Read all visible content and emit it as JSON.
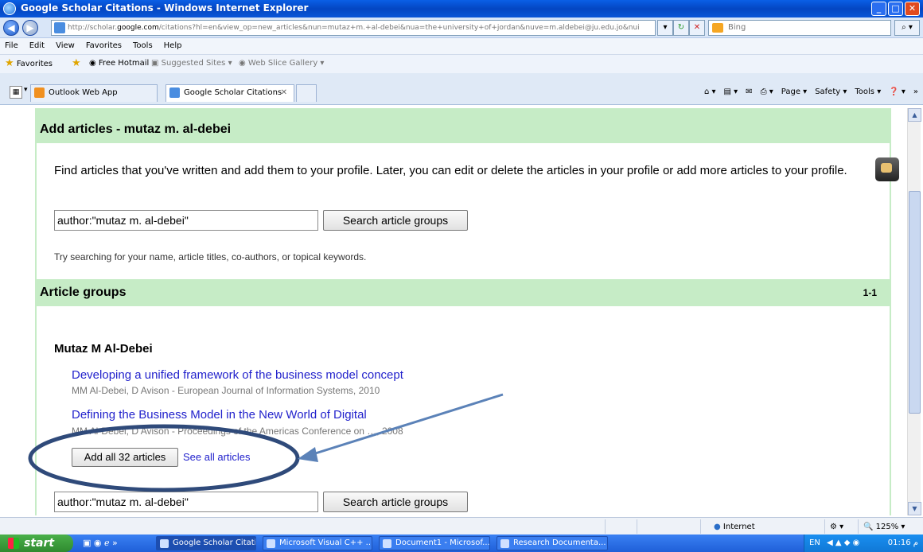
{
  "window": {
    "title": "Google Scholar Citations - Windows Internet Explorer",
    "min": "_",
    "max": "□",
    "close": "✕"
  },
  "address": {
    "url_prefix": "http://scholar.",
    "url_domain": "google.com",
    "url_rest": "/citations?hl=en&view_op=new_articles&nun=mutaz+m.+al-debei&nua=the+university+of+jordan&nuve=m.aldebei@ju.edu.jo&nui",
    "bing_placeholder": "Bing"
  },
  "menu": [
    "File",
    "Edit",
    "View",
    "Favorites",
    "Tools",
    "Help"
  ],
  "favorites_bar": {
    "favorites_label": "Favorites",
    "items": [
      "Free Hotmail",
      "Suggested Sites ▾",
      "Web Slice Gallery ▾"
    ]
  },
  "tabs": [
    {
      "label": "Outlook Web App",
      "active": false
    },
    {
      "label": "Google Scholar Citations",
      "active": true
    }
  ],
  "tab_tools": [
    "Page ▾",
    "Safety ▾",
    "Tools ▾"
  ],
  "page": {
    "add_header": "Add articles - mutaz m. al-debei",
    "description": "Find articles that you've written and add them to your profile. Later, you can edit or delete the articles in your profile or add more articles to your profile.",
    "search_value": "author:\"mutaz m. al-debei\"",
    "search_button": "Search article groups",
    "hint": "Try searching for your name, article titles, co-authors, or topical keywords.",
    "groups_header": "Article groups",
    "groups_count": "1-1",
    "group": {
      "author": "Mutaz M Al-Debei",
      "articles": [
        {
          "title": "Developing a unified framework of the business model concept",
          "meta": "MM Al-Debei, D Avison - European Journal of Information Systems, 2010"
        },
        {
          "title": "Defining the Business Model in the New World of Digital",
          "meta": "MM Al-Debei, D Avison - Proceedings of the Americas Conference on …, 2008"
        }
      ],
      "add_all_button": "Add all 32 articles",
      "see_all_link": "See all articles"
    },
    "bottom_search_value": "author:\"mutaz m. al-debei\"",
    "bottom_search_button": "Search article groups"
  },
  "status": {
    "zone": "Internet",
    "zoom": "125%"
  },
  "taskbar": {
    "start": "start",
    "tasks": [
      "Google Scholar Citati...",
      "Microsoft Visual C++ ...",
      "Document1 - Microsof...",
      "Research Documenta..."
    ],
    "lang": "EN",
    "time": "01:16 م"
  }
}
